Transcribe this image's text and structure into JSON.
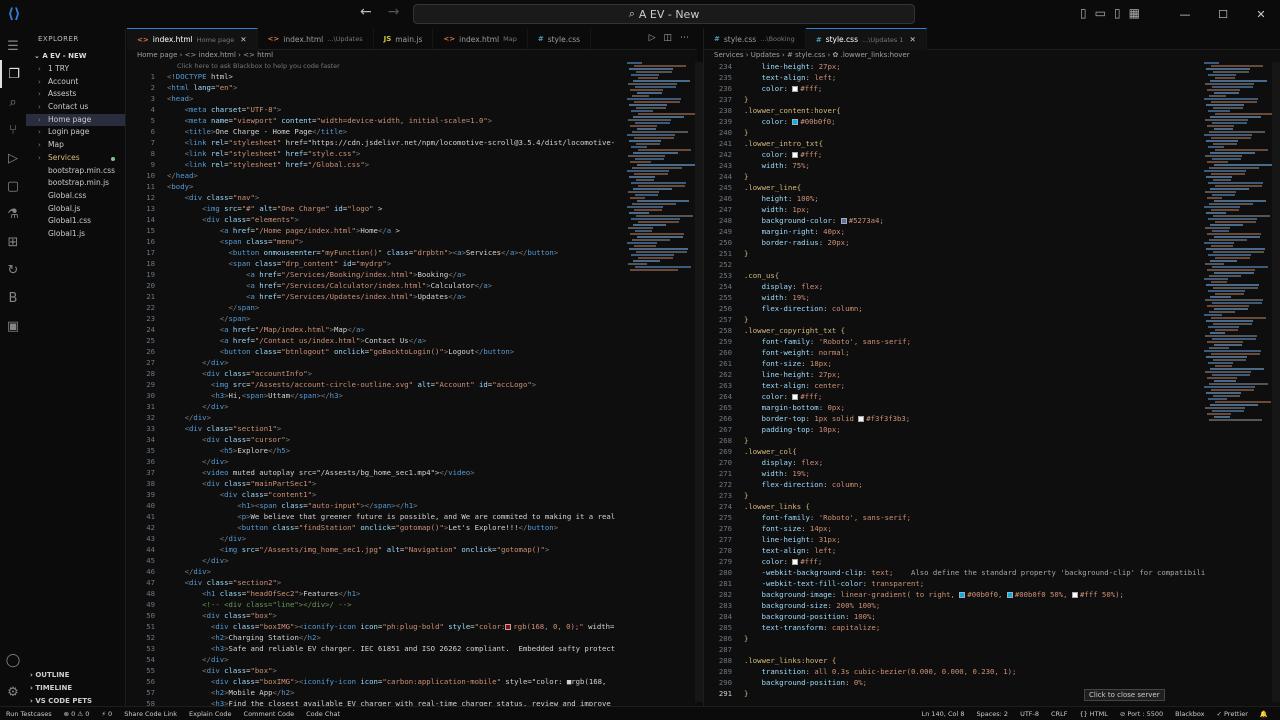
{
  "title": {
    "command_center": "A EV - New",
    "back_icon": "←",
    "forward_icon": "→"
  },
  "window": {
    "minimize": "—",
    "maximize": "☐",
    "close": "✕"
  },
  "sidebar": {
    "title": "EXPLORER",
    "folder": "A EV - NEW",
    "items": [
      {
        "label": "1 TRY",
        "type": "folder"
      },
      {
        "label": "Account",
        "type": "folder"
      },
      {
        "label": "Assests",
        "type": "folder"
      },
      {
        "label": "Contact us",
        "type": "folder"
      },
      {
        "label": "Home page",
        "type": "folder",
        "selected": true
      },
      {
        "label": "Login page",
        "type": "folder"
      },
      {
        "label": "Map",
        "type": "folder"
      },
      {
        "label": "Services",
        "type": "folder",
        "modified": true
      },
      {
        "label": "bootstrap.min.css",
        "type": "file"
      },
      {
        "label": "bootstrap.min.js",
        "type": "file"
      },
      {
        "label": "Global.css",
        "type": "file"
      },
      {
        "label": "Global.js",
        "type": "file"
      },
      {
        "label": "Global1.css",
        "type": "file"
      },
      {
        "label": "Global1.js",
        "type": "file"
      }
    ],
    "outline": "OUTLINE",
    "timeline": "TIMELINE",
    "vscode_pets": "VS CODE PETS"
  },
  "left_editor": {
    "tabs": [
      {
        "label": "index.html",
        "hint": "Home page",
        "icon": "<>",
        "kind": "html",
        "active": true,
        "close": "✕"
      },
      {
        "label": "index.html",
        "hint": "...\\Updates",
        "icon": "<>",
        "kind": "html"
      },
      {
        "label": "main.js",
        "hint": "",
        "icon": "JS",
        "kind": "js"
      },
      {
        "label": "index.html",
        "hint": "Map",
        "icon": "<>",
        "kind": "html"
      },
      {
        "label": "style.css",
        "hint": "",
        "icon": "#",
        "kind": "css"
      }
    ],
    "breadcrumb": "Home page  ›  <> index.html  ›  <> html",
    "hint": "Click here to ask Blackbox to help you code faster",
    "lines": [
      {
        "n": "1",
        "t": "<!DOCTYPE html>"
      },
      {
        "n": "2",
        "t": "<html lang=\"en\">"
      },
      {
        "n": "3",
        "t": "<head>"
      },
      {
        "n": "4",
        "t": "    <meta charset=\"UTF-8\">"
      },
      {
        "n": "5",
        "t": "    <meta name=\"viewport\" content=\"width=device-width, initial-scale=1.0\">"
      },
      {
        "n": "6",
        "t": "    <title>One Charge - Home Page</title>"
      },
      {
        "n": "7",
        "t": "    <link rel=\"stylesheet\" href=\"https://cdn.jsdelivr.net/npm/locomotive-scroll@3.5.4/dist/locomotive-"
      },
      {
        "n": "8",
        "t": "    <link rel=\"stylesheet\" href=\"style.css\">"
      },
      {
        "n": "9",
        "t": "    <link rel=\"stylesheet\" href=\"/Global.css\">"
      },
      {
        "n": "10",
        "t": "</head>"
      },
      {
        "n": "11",
        "t": "<body>"
      },
      {
        "n": "12",
        "t": "    <div class=\"nav\">"
      },
      {
        "n": "13",
        "t": "        <img src=\"#\" alt=\"One Charge\" id=\"logo\" >"
      },
      {
        "n": "14",
        "t": "        <div class=\"elements\">"
      },
      {
        "n": "15",
        "t": "            <a href=\"/Home page/index.html\">Home</a >"
      },
      {
        "n": "16",
        "t": "            <span class=\"menu\">"
      },
      {
        "n": "17",
        "t": "              <button onmouseenter=\"myFunction()\" class=\"drpbtn\"><a>Services</a></button>"
      },
      {
        "n": "18",
        "t": "              <span class=\"drp_content\" id=\"mydrp\">"
      },
      {
        "n": "19",
        "t": "                  <a href=\"/Services/Booking/index.html\">Booking</a>"
      },
      {
        "n": "20",
        "t": "                  <a href=\"/Services/Calculator/index.html\">Calculator</a>"
      },
      {
        "n": "21",
        "t": "                  <a href=\"/Services/Updates/index.html\">Updates</a>"
      },
      {
        "n": "22",
        "t": "              </span>"
      },
      {
        "n": "23",
        "t": "            </span>"
      },
      {
        "n": "24",
        "t": "            <a href=\"/Map/index.html\">Map</a>"
      },
      {
        "n": "25",
        "t": "            <a href=\"/Contact us/index.html\">Contact Us</a>"
      },
      {
        "n": "26",
        "t": "            <button class=\"btnlogout\" onclick=\"goBacktoLogin()\">Logout</button>"
      },
      {
        "n": "27",
        "t": "        </div>"
      },
      {
        "n": "28",
        "t": "        <div class=\"accountInfo\">"
      },
      {
        "n": "29",
        "t": "          <img src=\"/Assests/account-circle-outline.svg\" alt=\"Account\" id=\"accLogo\">"
      },
      {
        "n": "30",
        "t": "          <h3>Hi,<span>Uttam</span></h3>"
      },
      {
        "n": "31",
        "t": "        </div>"
      },
      {
        "n": "32",
        "t": "    </div>"
      },
      {
        "n": "33",
        "t": "    <div class=\"section1\">"
      },
      {
        "n": "34",
        "t": "        <div class=\"cursor\">"
      },
      {
        "n": "35",
        "t": "            <h5>Explore</h5>"
      },
      {
        "n": "36",
        "t": "        </div>"
      },
      {
        "n": "37",
        "t": "        <video muted autoplay src=\"/Assests/bg_home_sec1.mp4\"></video>"
      },
      {
        "n": "38",
        "t": "        <div class=\"mainPartSec1\">"
      },
      {
        "n": "39",
        "t": "            <div class=\"content1\">"
      },
      {
        "n": "40",
        "t": "                <h1><span class=\"auto-input\"></span></h1>"
      },
      {
        "n": "41",
        "t": "                <p>We believe that greener future is possible, and We are commited to making it a real"
      },
      {
        "n": "42",
        "t": "                <button class=\"findStation\" onclick=\"gotomap()\">Let's Explore!!!</button>"
      },
      {
        "n": "43",
        "t": "            </div>"
      },
      {
        "n": "44",
        "t": "            <img src=\"/Assests/img_home_sec1.jpg\" alt=\"Navigation\" onclick=\"gotomap()\">"
      },
      {
        "n": "45",
        "t": "        </div>"
      },
      {
        "n": "46",
        "t": "    </div>"
      },
      {
        "n": "47",
        "t": "    <div class=\"section2\">"
      },
      {
        "n": "48",
        "t": "        <h1 class=\"headOfSec2\">Features</h1>"
      },
      {
        "n": "49",
        "t": "        <!-- <div class=\"line\"></div>/ -->"
      },
      {
        "n": "50",
        "t": "        <div class=\"box\">"
      },
      {
        "n": "51",
        "t": "          <div class=\"boxIMG\"><iconify-icon icon=\"ph:plug-bold\" style=\"color:■rgb(168, 0, 0);\" width="
      },
      {
        "n": "52",
        "t": "          <h2>Charging Station</h2>"
      },
      {
        "n": "53",
        "t": "          <h3>Safe and reliable EV charger. IEC 61851 and ISO 26262 compliant.  Embedded safty protect"
      },
      {
        "n": "54",
        "t": "        </div>"
      },
      {
        "n": "55",
        "t": "        <div class=\"box\">"
      },
      {
        "n": "56",
        "t": "          <div class=\"boxIMG\"><iconify-icon icon=\"carbon:application-mobile\" style=\"color: ■rgb(168,"
      },
      {
        "n": "57",
        "t": "          <h2>Mobile App</h2>"
      },
      {
        "n": "58",
        "t": "          <h3>Find the closest available EV charger with real-time charger status, review and improve"
      }
    ]
  },
  "right_editor": {
    "tabs": [
      {
        "label": "style.css",
        "hint": "...\\Booking",
        "icon": "#",
        "kind": "css"
      },
      {
        "label": "style.css",
        "hint": "...\\Updates 1",
        "icon": "#",
        "kind": "css",
        "active": true,
        "close": "✕"
      }
    ],
    "breadcrumb": "Services  ›  Updates  ›  # style.css  ›  ✿ .lowwer_links:hover",
    "lines": [
      {
        "n": "234",
        "t": "    line-height: 27px;"
      },
      {
        "n": "235",
        "t": "    text-align: left;"
      },
      {
        "n": "236",
        "t": "    color: ■#fff;"
      },
      {
        "n": "237",
        "t": "}"
      },
      {
        "n": "238",
        "t": ".lowwer_content:hover{"
      },
      {
        "n": "239",
        "t": "    color: ■#00b0f0;"
      },
      {
        "n": "240",
        "t": "}"
      },
      {
        "n": "241",
        "t": ".lowwer_intro_txt{"
      },
      {
        "n": "242",
        "t": "    color: ■#fff;"
      },
      {
        "n": "243",
        "t": "    width: 75%;"
      },
      {
        "n": "244",
        "t": "}"
      },
      {
        "n": "245",
        "t": ".lowwer_line{"
      },
      {
        "n": "246",
        "t": "    height: 100%;"
      },
      {
        "n": "247",
        "t": "    width: 1px;"
      },
      {
        "n": "248",
        "t": "    background-color: ■#5273a4;"
      },
      {
        "n": "249",
        "t": "    margin-right: 40px;"
      },
      {
        "n": "250",
        "t": "    border-radius: 20px;"
      },
      {
        "n": "251",
        "t": "}"
      },
      {
        "n": "252",
        "t": ""
      },
      {
        "n": "253",
        "t": ".con_us{"
      },
      {
        "n": "254",
        "t": "    display: flex;"
      },
      {
        "n": "255",
        "t": "    width: 19%;"
      },
      {
        "n": "256",
        "t": "    flex-direction: column;"
      },
      {
        "n": "257",
        "t": "}"
      },
      {
        "n": "258",
        "t": ".lowwer_copyright_txt {"
      },
      {
        "n": "259",
        "t": "    font-family: 'Roboto', sans-serif;"
      },
      {
        "n": "260",
        "t": "    font-weight: normal;"
      },
      {
        "n": "261",
        "t": "    font-size: 18px;"
      },
      {
        "n": "262",
        "t": "    line-height: 27px;"
      },
      {
        "n": "263",
        "t": "    text-align: center;"
      },
      {
        "n": "264",
        "t": "    color: ■#fff;"
      },
      {
        "n": "265",
        "t": "    margin-bottom: 0px;"
      },
      {
        "n": "266",
        "t": "    border-top: 1px solid ■#f3f3f3b3;"
      },
      {
        "n": "267",
        "t": "    padding-top: 10px;"
      },
      {
        "n": "268",
        "t": "}"
      },
      {
        "n": "269",
        "t": ".lowwer_col{"
      },
      {
        "n": "270",
        "t": "    display: flex;"
      },
      {
        "n": "271",
        "t": "    width: 19%;"
      },
      {
        "n": "272",
        "t": "    flex-direction: column;"
      },
      {
        "n": "273",
        "t": "}"
      },
      {
        "n": "274",
        "t": ".lowwer_links {"
      },
      {
        "n": "275",
        "t": "    font-family: 'Roboto', sans-serif;"
      },
      {
        "n": "276",
        "t": "    font-size: 14px;"
      },
      {
        "n": "277",
        "t": "    line-height: 31px;"
      },
      {
        "n": "278",
        "t": "    text-align: left;"
      },
      {
        "n": "279",
        "t": "    color: ■#fff;"
      },
      {
        "n": "280",
        "t": "    -webkit-background-clip: text;    Also define the standard property 'background-clip' for compatibili"
      },
      {
        "n": "281",
        "t": "    -webkit-text-fill-color: transparent;"
      },
      {
        "n": "282",
        "t": "    background-image: linear-gradient( to right, ■#00b0f0, ■#00b0f0 50%, ■#fff 50%);"
      },
      {
        "n": "283",
        "t": "    background-size: 200% 100%;"
      },
      {
        "n": "284",
        "t": "    background-position: 100%;"
      },
      {
        "n": "285",
        "t": "    text-transform: capitalize;"
      },
      {
        "n": "286",
        "t": "}"
      },
      {
        "n": "287",
        "t": ""
      },
      {
        "n": "288",
        "t": ".lowwer_links:hover {"
      },
      {
        "n": "289",
        "t": "    transition: all 0.3s cubic-bezier(0.000, 0.000, 0.230, 1);"
      },
      {
        "n": "290",
        "t": "    background-position: 0%;"
      },
      {
        "n": "291",
        "t": "}"
      }
    ]
  },
  "tooltip": "Click to close server",
  "status": {
    "left": [
      "Run Testcases",
      "⊗ 0 ⚠ 0",
      "⚡ 0",
      "Share Code Link",
      "Explain Code",
      "Comment Code",
      "Code Chat"
    ],
    "right": [
      "Ln 140, Col 8",
      "Spaces: 2",
      "UTF-8",
      "CRLF",
      "{} HTML",
      "⊘ Port : 5500",
      "Blackbox",
      "✓ Prettier",
      "🔔"
    ]
  },
  "colors": {
    "accent": "#2f80d8",
    "bg": "#0e0e0e"
  }
}
